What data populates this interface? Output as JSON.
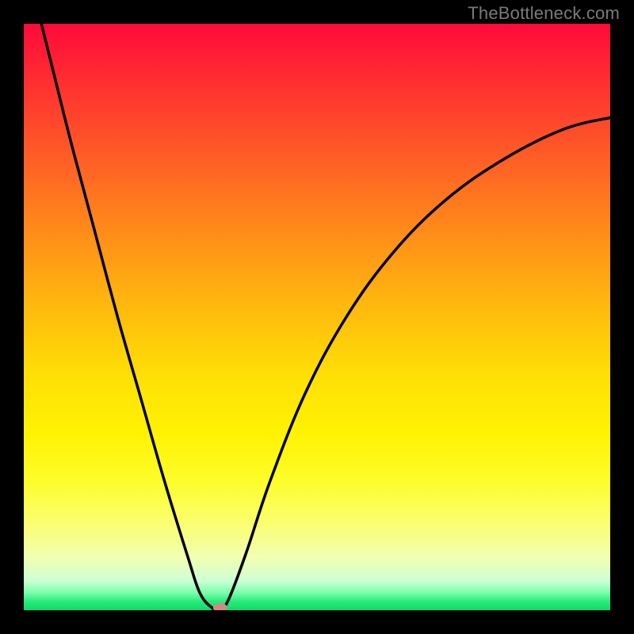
{
  "attribution": "TheBottleneck.com",
  "chart_data": {
    "type": "line",
    "title": "",
    "xlabel": "",
    "ylabel": "",
    "xlim": [
      0,
      100
    ],
    "ylim": [
      0,
      100
    ],
    "grid": false,
    "legend": false,
    "background_gradient": {
      "top_color": "#ff0a3a",
      "bottom_color": "#0fd968",
      "description": "vertical gradient red (top/high mismatch) to green (bottom/optimal)"
    },
    "series": [
      {
        "name": "bottleneck-curve",
        "color": "#000000",
        "x": [
          3,
          5,
          8,
          12,
          16,
          20,
          24,
          28,
          30,
          32,
          33.5,
          35,
          38,
          42,
          48,
          55,
          63,
          72,
          82,
          92,
          100
        ],
        "y": [
          100,
          92,
          80,
          65,
          50,
          36,
          22,
          9,
          3,
          0.5,
          0,
          2,
          10,
          22,
          37,
          50,
          61,
          70,
          77,
          82,
          84
        ]
      }
    ],
    "marker": {
      "name": "optimal-point",
      "x": 33.5,
      "y": 0,
      "color": "#d08a86",
      "shape": "rounded-oval"
    }
  }
}
